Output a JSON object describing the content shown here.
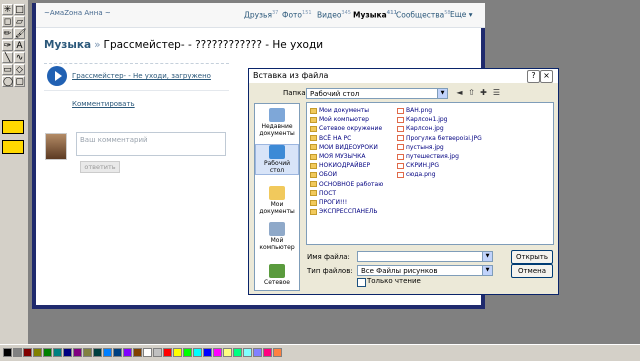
{
  "vk": {
    "user": "~АмаZoна Анна ~",
    "nav": [
      {
        "label": "Друзья",
        "count": "37"
      },
      {
        "label": "Фото",
        "count": "151"
      },
      {
        "label": "Видео",
        "count": "345"
      },
      {
        "label": "Музыка",
        "count": "411"
      },
      {
        "label": "Сообщества",
        "count": "58"
      },
      {
        "label": "Еще",
        "count": ""
      }
    ],
    "breadcrumb_music": "Музыка",
    "breadcrumb_sep": "»",
    "breadcrumb_title": "Грассмейстер- - ???????????? - Не уходи",
    "track": "Грассмейстер- - Не уходи, загружено",
    "comment_link": "Комментировать",
    "comment_placeholder": "Ваш комментарий",
    "reply_btn": "ответить"
  },
  "dialog": {
    "title": "Вставка из файла",
    "help": "?",
    "close": "×",
    "folder_label": "Папка:",
    "folder_value": "Рабочий стол",
    "places": [
      "Недавние документы",
      "Рабочий стол",
      "Мои документы",
      "Мой компьютер",
      "Сетевое"
    ],
    "files_col1": [
      {
        "name": "Мои документы",
        "type": "folder"
      },
      {
        "name": "Мой компьютер",
        "type": "folder"
      },
      {
        "name": "Сетевое окружение",
        "type": "folder"
      },
      {
        "name": "ВСЁ НА PC",
        "type": "folder"
      },
      {
        "name": "МОИ ВИДЕОУРОКИ",
        "type": "folder"
      },
      {
        "name": "МОЯ МУЗЫЧКА",
        "type": "folder"
      },
      {
        "name": "НОКИОДРАЙВЕР",
        "type": "folder"
      },
      {
        "name": "ОБОИ",
        "type": "folder"
      },
      {
        "name": "ОСНОВНОЕ работаю",
        "type": "folder"
      },
      {
        "name": "ПОСТ",
        "type": "folder"
      },
      {
        "name": "ПРОГИ!!!",
        "type": "folder"
      },
      {
        "name": "ЭКСПРЕССПАНЕЛЬ",
        "type": "folder"
      }
    ],
    "files_col2": [
      {
        "name": "ВАН.png",
        "type": "img"
      },
      {
        "name": "Карлсон1.jpg",
        "type": "img"
      },
      {
        "name": "Карлсон.jpg",
        "type": "img"
      },
      {
        "name": "Прогулка бетвероізі.JPG",
        "type": "img"
      },
      {
        "name": "пустыня.jpg",
        "type": "img"
      },
      {
        "name": "путешествия.jpg",
        "type": "img"
      },
      {
        "name": "СКРИН.JPG",
        "type": "img"
      },
      {
        "name": "сюда.png",
        "type": "img"
      }
    ],
    "filename_label": "Имя файла:",
    "filename_value": "",
    "filetype_label": "Тип файлов:",
    "filetype_value": "Все Файлы рисунков",
    "readonly_label": "Только чтение",
    "open_btn": "Открыть",
    "cancel_btn": "Отмена"
  },
  "paint": {
    "tools": [
      "✳",
      "□",
      "◻",
      "▱",
      "✏",
      "🖌",
      "✑",
      "A",
      "╲",
      "∿",
      "▭",
      "◇",
      "◯",
      "▢"
    ],
    "palette": [
      "#000000",
      "#808080",
      "#800000",
      "#808000",
      "#008000",
      "#008080",
      "#000080",
      "#800080",
      "#808040",
      "#004040",
      "#0080ff",
      "#004080",
      "#8000ff",
      "#804000",
      "#ffffff",
      "#c0c0c0",
      "#ff0000",
      "#ffff00",
      "#00ff00",
      "#00ffff",
      "#0000ff",
      "#ff00ff",
      "#ffff80",
      "#00ff80",
      "#80ffff",
      "#8080ff",
      "#ff0080",
      "#ff8040"
    ]
  }
}
